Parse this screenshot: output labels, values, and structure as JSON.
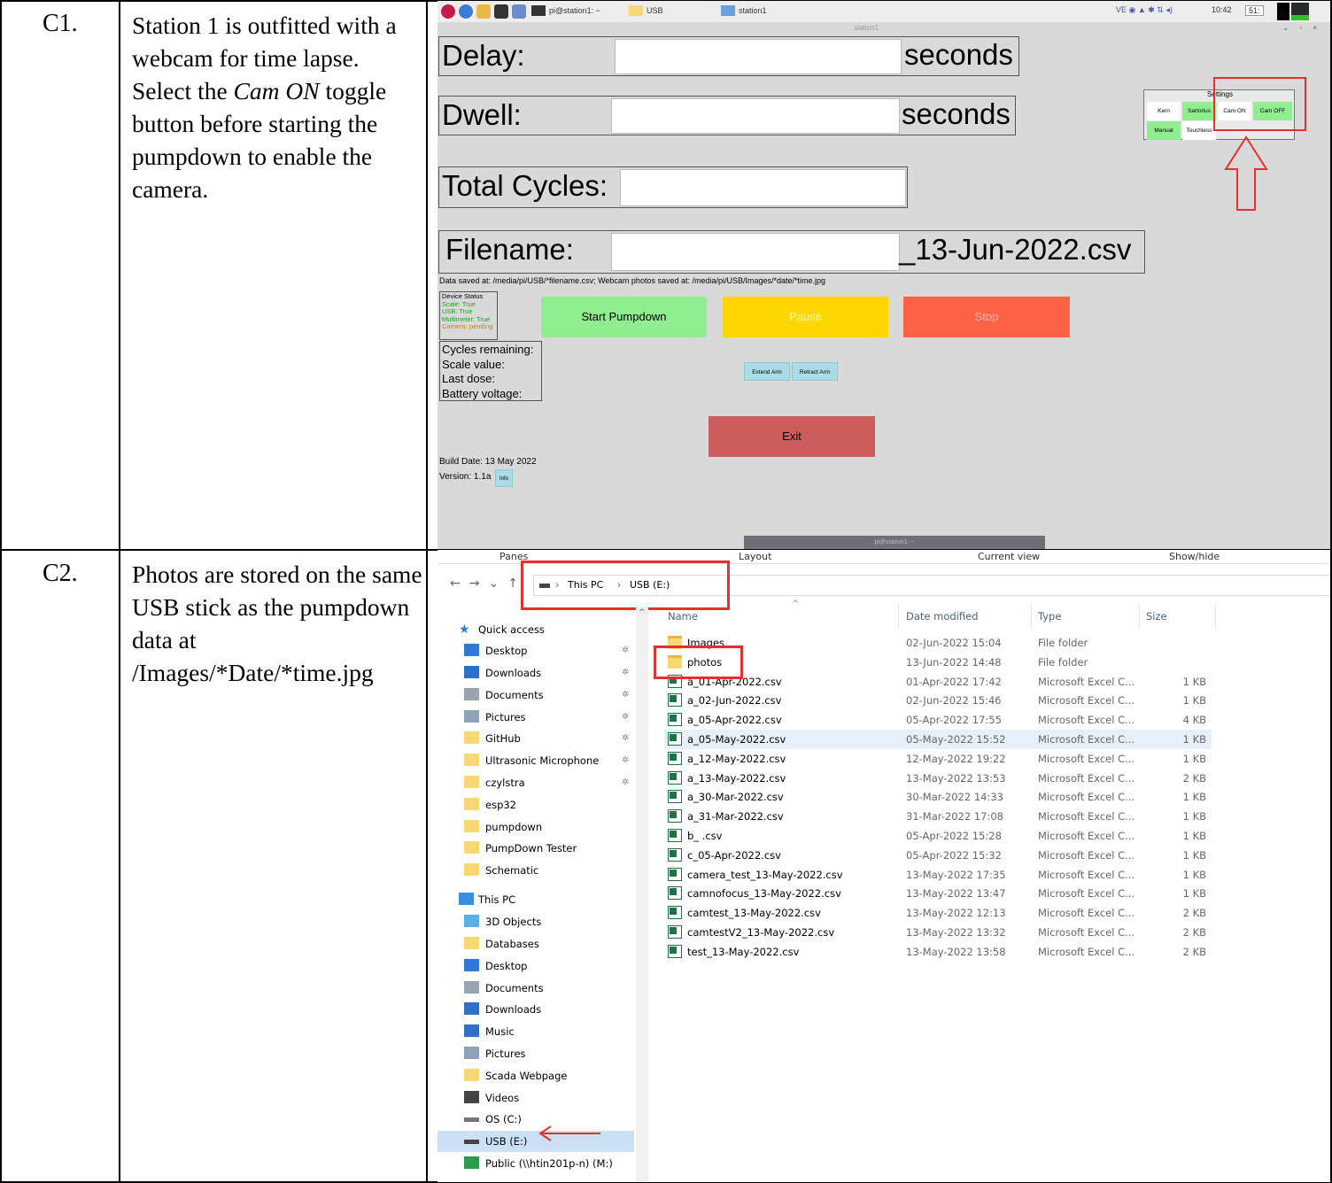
{
  "doc": {
    "rows": [
      {
        "step": "C1.",
        "text_parts": [
          "Station 1 is outfitted with a webcam for time lapse. Select the ",
          "Cam ON",
          " toggle button before starting the pumpdown to enable the camera."
        ]
      },
      {
        "step": "C2.",
        "text": "Photos are stored on the same USB stick as the pumpdown data at /Images/*Date/*time.jpg"
      }
    ]
  },
  "rpi_app": {
    "taskbar": {
      "items": [
        "pi@station1: ~",
        "USB",
        "station1"
      ],
      "clock": "10:42",
      "battery": "51:"
    },
    "window_title": "station1",
    "window_controls": "⌄ ▫ ×",
    "fields": {
      "delay_label": "Delay:",
      "delay_unit": "seconds",
      "dwell_label": "Dwell:",
      "dwell_unit": "seconds",
      "cycles_label": "Total Cycles:",
      "filename_label": "Filename:",
      "filename_suffix": "_13-Jun-2022.csv"
    },
    "save_note": "Data saved at: /media/pi/USB/*filename.csv;   Webcam photos saved at: /media/pi/USB/Images/*date/*time.jpg",
    "device_status": {
      "title": "Device Status",
      "scale": "Scale: True",
      "usb": "USB: True",
      "multimeter": "Multimeter: True",
      "camera": "Camera: pending"
    },
    "info_lines": [
      "Cycles remaining:",
      "Scale value:",
      "Last dose:",
      "Battery voltage:"
    ],
    "buttons": {
      "start": "Start Pumpdown",
      "pause": "Pause",
      "stop": "Stop",
      "extend": "Extend Arm",
      "retract": "Retract Arm",
      "exit": "Exit",
      "info": "Info"
    },
    "settings": {
      "title": "Settings",
      "kern": "Kern",
      "sartorius": "Sartorius",
      "cam_on": "Cam ON",
      "cam_off": "Cam OFF",
      "manual": "Manual",
      "touchless": "Touchless"
    },
    "build_date": "Build Date: 13 May 2022",
    "version": "Version: 1.1a",
    "bottom_bar": "pi@station1: ~",
    "colors": {
      "green": "#90ee90",
      "yellow": "#ffd700",
      "orange_red": "#ff6347",
      "exit_red": "#cd5c5c",
      "annotation_red": "#e53030"
    }
  },
  "explorer": {
    "ribbon": [
      "Panes",
      "Layout",
      "Current view",
      "Show/hide"
    ],
    "address": [
      "This PC",
      "USB (E:)"
    ],
    "columns": [
      "Name",
      "Date modified",
      "Type",
      "Size"
    ],
    "nav": [
      {
        "label": "Quick access",
        "icon": "star-icon",
        "top": true
      },
      {
        "label": "Desktop",
        "icon": "desktop-icon",
        "pin": true
      },
      {
        "label": "Downloads",
        "icon": "download-icon",
        "pin": true
      },
      {
        "label": "Documents",
        "icon": "document-icon",
        "pin": true
      },
      {
        "label": "Pictures",
        "icon": "pictures-icon",
        "pin": true
      },
      {
        "label": "GitHub",
        "icon": "folder-icon",
        "pin": true
      },
      {
        "label": "Ultrasonic Microphone",
        "icon": "folder-icon",
        "pin": true
      },
      {
        "label": "czylstra",
        "icon": "folder-icon",
        "pin": true
      },
      {
        "label": "esp32",
        "icon": "folder-icon"
      },
      {
        "label": "pumpdown",
        "icon": "folder-icon"
      },
      {
        "label": "PumpDown Tester",
        "icon": "folder-icon"
      },
      {
        "label": "Schematic",
        "icon": "folder-icon"
      },
      {
        "label": "This PC",
        "icon": "computer-icon",
        "top": true
      },
      {
        "label": "3D Objects",
        "icon": "cube-icon"
      },
      {
        "label": "Databases",
        "icon": "folder-icon"
      },
      {
        "label": "Desktop",
        "icon": "desktop-icon"
      },
      {
        "label": "Documents",
        "icon": "document-icon"
      },
      {
        "label": "Downloads",
        "icon": "download-icon"
      },
      {
        "label": "Music",
        "icon": "music-icon"
      },
      {
        "label": "Pictures",
        "icon": "pictures-icon"
      },
      {
        "label": "Scada Webpage",
        "icon": "folder-icon"
      },
      {
        "label": "Videos",
        "icon": "video-icon"
      },
      {
        "label": "OS (C:)",
        "icon": "drive-icon"
      },
      {
        "label": "USB (E:)",
        "icon": "usb-drive-icon",
        "selected": true
      },
      {
        "label": "Public (\\\\htin201p-n) (M:)",
        "icon": "network-drive-icon"
      }
    ],
    "files": [
      {
        "name": "Images",
        "date": "02-Jun-2022 15:04",
        "type": "File folder",
        "size": "",
        "kind": "folder"
      },
      {
        "name": "photos",
        "date": "13-Jun-2022 14:48",
        "type": "File folder",
        "size": "",
        "kind": "folder"
      },
      {
        "name": "a_01-Apr-2022.csv",
        "date": "01-Apr-2022 17:42",
        "type": "Microsoft Excel C...",
        "size": "1 KB",
        "kind": "excel"
      },
      {
        "name": "a_02-Jun-2022.csv",
        "date": "02-Jun-2022 15:46",
        "type": "Microsoft Excel C...",
        "size": "1 KB",
        "kind": "excel"
      },
      {
        "name": "a_05-Apr-2022.csv",
        "date": "05-Apr-2022 17:55",
        "type": "Microsoft Excel C...",
        "size": "4 KB",
        "kind": "excel"
      },
      {
        "name": "a_05-May-2022.csv",
        "date": "05-May-2022 15:52",
        "type": "Microsoft Excel C...",
        "size": "1 KB",
        "kind": "excel",
        "selected": true
      },
      {
        "name": "a_12-May-2022.csv",
        "date": "12-May-2022 19:22",
        "type": "Microsoft Excel C...",
        "size": "1 KB",
        "kind": "excel"
      },
      {
        "name": "a_13-May-2022.csv",
        "date": "13-May-2022 13:53",
        "type": "Microsoft Excel C...",
        "size": "2 KB",
        "kind": "excel"
      },
      {
        "name": "a_30-Mar-2022.csv",
        "date": "30-Mar-2022 14:33",
        "type": "Microsoft Excel C...",
        "size": "1 KB",
        "kind": "excel"
      },
      {
        "name": "a_31-Mar-2022.csv",
        "date": "31-Mar-2022 17:08",
        "type": "Microsoft Excel C...",
        "size": "1 KB",
        "kind": "excel"
      },
      {
        "name": "b_ .csv",
        "date": "05-Apr-2022 15:28",
        "type": "Microsoft Excel C...",
        "size": "1 KB",
        "kind": "excel"
      },
      {
        "name": "c_05-Apr-2022.csv",
        "date": "05-Apr-2022 15:32",
        "type": "Microsoft Excel C...",
        "size": "1 KB",
        "kind": "excel"
      },
      {
        "name": "camera_test_13-May-2022.csv",
        "date": "13-May-2022 17:35",
        "type": "Microsoft Excel C...",
        "size": "1 KB",
        "kind": "excel"
      },
      {
        "name": "camnofocus_13-May-2022.csv",
        "date": "13-May-2022 13:47",
        "type": "Microsoft Excel C...",
        "size": "1 KB",
        "kind": "excel"
      },
      {
        "name": "camtest_13-May-2022.csv",
        "date": "13-May-2022 12:13",
        "type": "Microsoft Excel C...",
        "size": "2 KB",
        "kind": "excel"
      },
      {
        "name": "camtestV2_13-May-2022.csv",
        "date": "13-May-2022 13:32",
        "type": "Microsoft Excel C...",
        "size": "2 KB",
        "kind": "excel"
      },
      {
        "name": "test_13-May-2022.csv",
        "date": "13-May-2022 13:58",
        "type": "Microsoft Excel C...",
        "size": "2 KB",
        "kind": "excel"
      }
    ]
  }
}
